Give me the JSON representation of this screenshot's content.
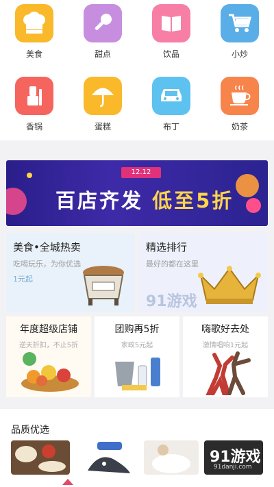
{
  "categories": [
    {
      "label": "美食",
      "icon": "chef-hat-icon",
      "color": "#f9b92a"
    },
    {
      "label": "甜点",
      "icon": "microphone-icon",
      "color": "#c78ee0"
    },
    {
      "label": "饮品",
      "icon": "book-icon",
      "color": "#f77fa6"
    },
    {
      "label": "小炒",
      "icon": "shopping-cart-icon",
      "color": "#5aaee8"
    },
    {
      "label": "香锅",
      "icon": "lipstick-icon",
      "color": "#f6645e"
    },
    {
      "label": "蛋糕",
      "icon": "umbrella-icon",
      "color": "#f9b92a"
    },
    {
      "label": "布丁",
      "icon": "car-icon",
      "color": "#5ec2f0"
    },
    {
      "label": "奶茶",
      "icon": "coffee-cup-icon",
      "color": "#f7844a"
    }
  ],
  "banner": {
    "tag": "12.12",
    "headline_a": "百店齐发",
    "headline_b": "低至5折"
  },
  "promos": [
    {
      "title": "美食•全城热卖",
      "subtitle": "吃喝玩乐，为你优选",
      "price": "1元起"
    },
    {
      "title": "精选排行",
      "subtitle": "最好的都在这里"
    }
  ],
  "deals": [
    {
      "title": "年度超级店铺",
      "subtitle": "逆天折扣，不止5折"
    },
    {
      "title": "团购再5折",
      "subtitle": "家政5元起"
    },
    {
      "title": "嗨歌好去处",
      "subtitle": "激情唱响1元起"
    }
  ],
  "quality": {
    "heading": "品质优选"
  },
  "watermark": {
    "brand": "91游戏",
    "site": "91danji.com"
  }
}
